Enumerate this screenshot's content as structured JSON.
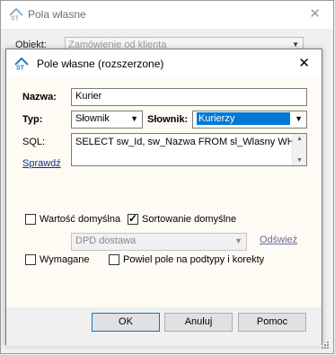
{
  "background_window": {
    "title": "Pola własne",
    "object_label": "Obiekt:",
    "object_value": "Zamówienie od klienta"
  },
  "dialog": {
    "title": "Pole własne (rozszerzone)",
    "name_label": "Nazwa:",
    "name_value": "Kurier",
    "type_label": "Typ:",
    "type_value": "Słownik",
    "dictionary_label": "Słownik:",
    "dictionary_value": "Kurierzy",
    "sql_label": "SQL:",
    "check_link": "Sprawdź",
    "sql_value": "SELECT sw_Id, sw_Nazwa FROM sl_Wlasny WHE",
    "default_value_label": "Wartość domyślna",
    "default_value_checked": false,
    "default_sort_label": "Sortowanie domyślne",
    "default_sort_checked": true,
    "default_value_select": "DPD dostawa",
    "refresh_link": "Odśwież",
    "required_label": "Wymagane",
    "required_checked": false,
    "repeat_label": "Powiel pole na podtypy i korekty",
    "repeat_checked": false,
    "ok_label": "OK",
    "cancel_label": "Anuluj",
    "help_label": "Pomoc"
  },
  "colors": {
    "selection": "#0078d7",
    "link": "#0b2e8a",
    "dialog_bg": "#fdfbf3"
  },
  "icons": {
    "app": "app-logo-icon",
    "close": "close-icon",
    "dropdown": "chevron-down-icon",
    "check": "check-icon"
  }
}
